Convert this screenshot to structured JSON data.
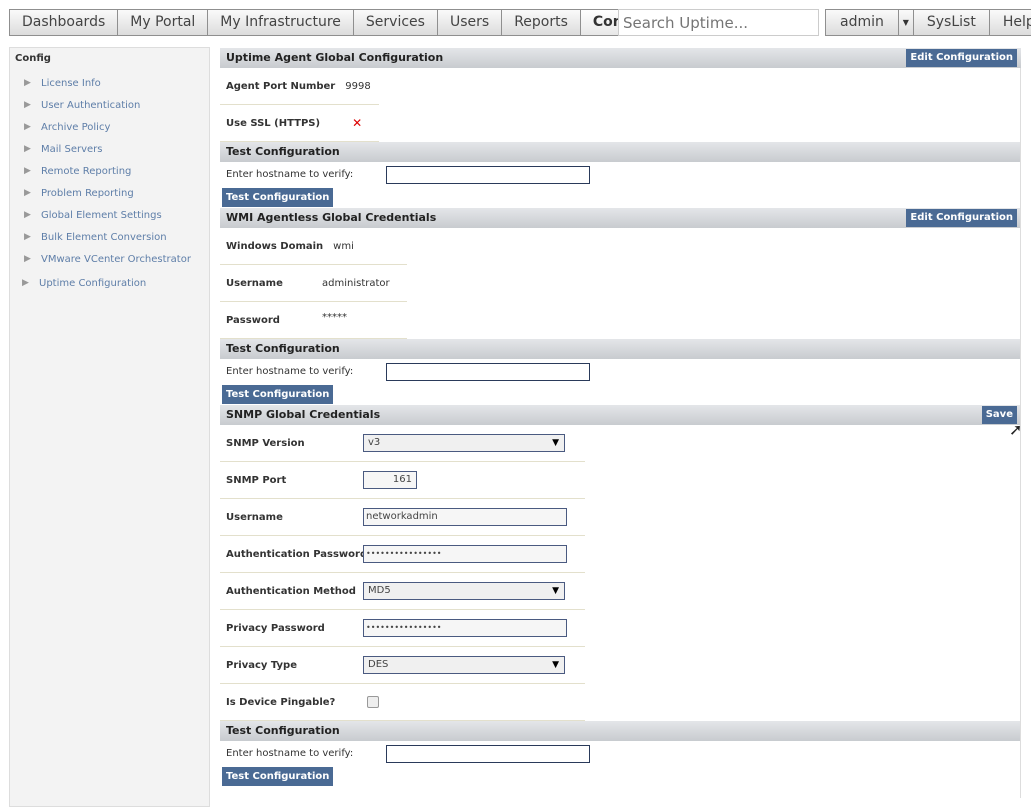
{
  "nav": {
    "tabs": [
      "Dashboards",
      "My Portal",
      "My Infrastructure",
      "Services",
      "Users",
      "Reports",
      "Config"
    ],
    "active": "Config",
    "search_placeholder": "Search Uptime...",
    "user": "admin",
    "syslist": "SysList",
    "help": "Help"
  },
  "sidebar": {
    "title": "Config",
    "items": [
      "License Info",
      "User Authentication",
      "Archive Policy",
      "Mail Servers",
      "Remote Reporting",
      "Problem Reporting",
      "Global Element Settings",
      "Bulk Element Conversion",
      "VMware VCenter Orchestrator",
      "Uptime Configuration"
    ]
  },
  "agent": {
    "title": "Uptime Agent Global Configuration",
    "edit": "Edit Configuration",
    "port_label": "Agent Port Number",
    "port": "9998",
    "ssl_label": "Use SSL (HTTPS)",
    "ssl_value": "✕"
  },
  "test": {
    "title": "Test Configuration",
    "prompt": "Enter hostname to verify:",
    "button": "Test Configuration"
  },
  "wmi": {
    "title": "WMI Agentless Global Credentials",
    "edit": "Edit Configuration",
    "domain_label": "Windows Domain",
    "domain": "wmi",
    "user_label": "Username",
    "user": "administrator",
    "pass_label": "Password",
    "pass": "*****"
  },
  "snmp": {
    "title": "SNMP Global Credentials",
    "save": "Save",
    "version_label": "SNMP Version",
    "version": "v3",
    "port_label": "SNMP Port",
    "port": "161",
    "user_label": "Username",
    "user": "networkadmin",
    "authpass_label": "Authentication Password",
    "authpass": "••••••••••••••••",
    "authmethod_label": "Authentication Method",
    "authmethod": "MD5",
    "privpass_label": "Privacy Password",
    "privpass": "••••••••••••••••",
    "privtype_label": "Privacy Type",
    "privtype": "DES",
    "ping_label": "Is Device Pingable?",
    "pingable": false
  }
}
